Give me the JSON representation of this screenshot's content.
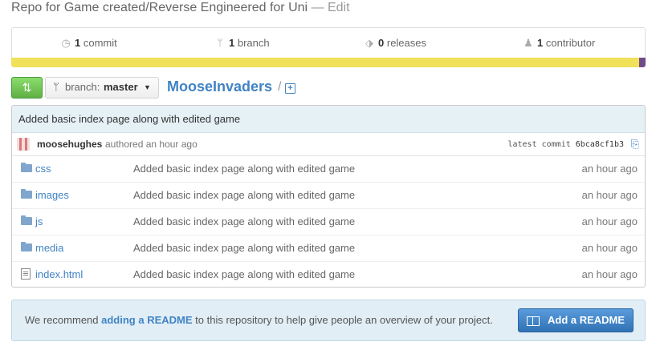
{
  "repo": {
    "description": "Repo for Game created/Reverse Engineered for Uni",
    "edit_label": "— Edit",
    "name": "MooseInvaders",
    "slash": "/",
    "new_file": "+"
  },
  "summary": {
    "commits": {
      "count": "1",
      "label": "commit",
      "icon": "history-icon"
    },
    "branches": {
      "count": "1",
      "label": "branch",
      "icon": "branch-icon"
    },
    "releases": {
      "count": "0",
      "label": "releases",
      "icon": "tag-icon"
    },
    "contributors": {
      "count": "1",
      "label": "contributor",
      "icon": "organization-icon"
    }
  },
  "language_bar": {
    "colors": {
      "primary": "#f1e05a",
      "secondary": "#6e4c8a"
    },
    "primary_fraction": 0.99
  },
  "toolbar": {
    "compare_icon": "⇅",
    "branch_label": "branch:",
    "branch_name": "master",
    "caret": "▼"
  },
  "commit": {
    "message": "Added basic index page along with edited game",
    "author": "moosehughes",
    "authored": "authored an hour ago",
    "latest_label": "latest commit",
    "sha": "6bca8cf1b3"
  },
  "files": [
    {
      "name": "css",
      "type": "folder",
      "message": "Added basic index page along with edited game",
      "age": "an hour ago"
    },
    {
      "name": "images",
      "type": "folder",
      "message": "Added basic index page along with edited game",
      "age": "an hour ago"
    },
    {
      "name": "js",
      "type": "folder",
      "message": "Added basic index page along with edited game",
      "age": "an hour ago"
    },
    {
      "name": "media",
      "type": "folder",
      "message": "Added basic index page along with edited game",
      "age": "an hour ago"
    },
    {
      "name": "index.html",
      "type": "file",
      "message": "Added basic index page along with edited game",
      "age": "an hour ago"
    }
  ],
  "readme": {
    "text_before": "We recommend",
    "link": "adding a README",
    "text_after": "to this repository to help give people an overview of your project.",
    "button": "Add a README"
  },
  "colors": {
    "link": "#4183c4",
    "accent_green": "#60b044",
    "readme_bg": "#e1eef6"
  }
}
